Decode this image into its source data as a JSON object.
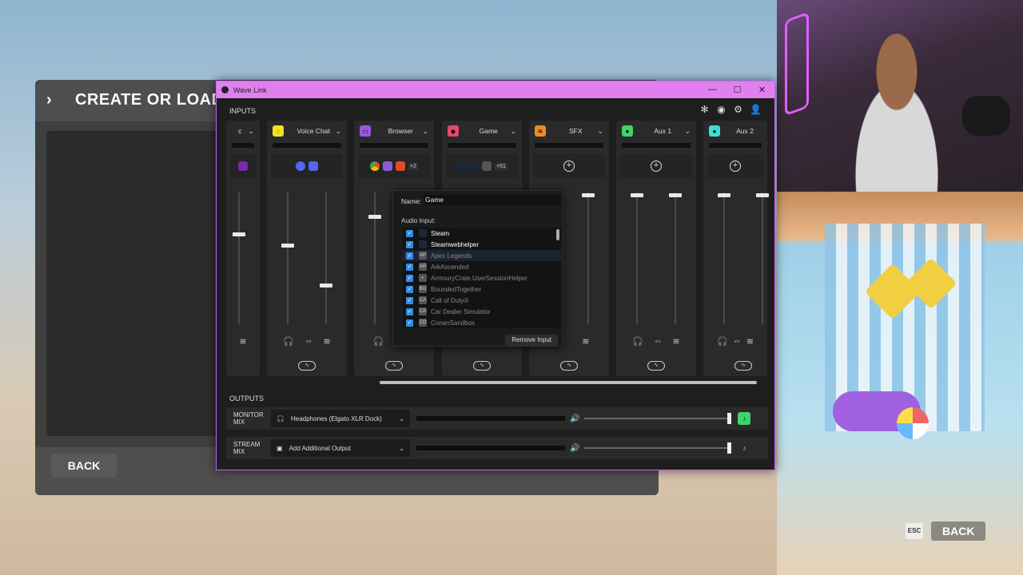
{
  "game": {
    "title": "CREATE OR LOAD",
    "back_label": "BACK"
  },
  "overlay_back": {
    "esc_label": "ESC",
    "back_label": "BACK"
  },
  "window": {
    "title": "Wave Link",
    "minimize": "—",
    "maximize": "☐",
    "close": "✕"
  },
  "inputs_label": "INPUTS",
  "outputs_label": "OUTPUTS",
  "channels": [
    {
      "name": "c",
      "color": "#a040d0"
    },
    {
      "name": "Voice Chat",
      "color": "#f2e21f"
    },
    {
      "name": "Browser",
      "color": "#9a58e6"
    },
    {
      "name": "Game",
      "color": "#e64a6a"
    },
    {
      "name": "SFX",
      "color": "#f08a24"
    },
    {
      "name": "Aux 1",
      "color": "#3fd46a"
    },
    {
      "name": "Aux 2",
      "color": "#3ae0d0"
    }
  ],
  "browser_extra": "+2",
  "game_extra": "+51",
  "popup": {
    "name_label": "Name:",
    "name_value": "Game",
    "audio_input_label": "Audio Input:",
    "items": [
      {
        "label": "Steam",
        "active": true
      },
      {
        "label": "Steamwebhelper",
        "active": true
      },
      {
        "label": "Apex Legends",
        "active": false
      },
      {
        "label": "ArkAscended",
        "active": false
      },
      {
        "label": "ArmouryCrate.UserSessionHelper",
        "active": false
      },
      {
        "label": "BoundedTogether",
        "active": false
      },
      {
        "label": "Call of Duty®",
        "active": false
      },
      {
        "label": "Car Dealer Simulator",
        "active": false
      },
      {
        "label": "ConanSandbox",
        "active": false
      }
    ],
    "remove_label": "Remove Input"
  },
  "monitor_mix": {
    "label": "MONITOR MIX",
    "device": "Headphones (Elgato XLR Dock)"
  },
  "stream_mix": {
    "label": "STREAM MIX",
    "device": "Add Additional Output"
  }
}
